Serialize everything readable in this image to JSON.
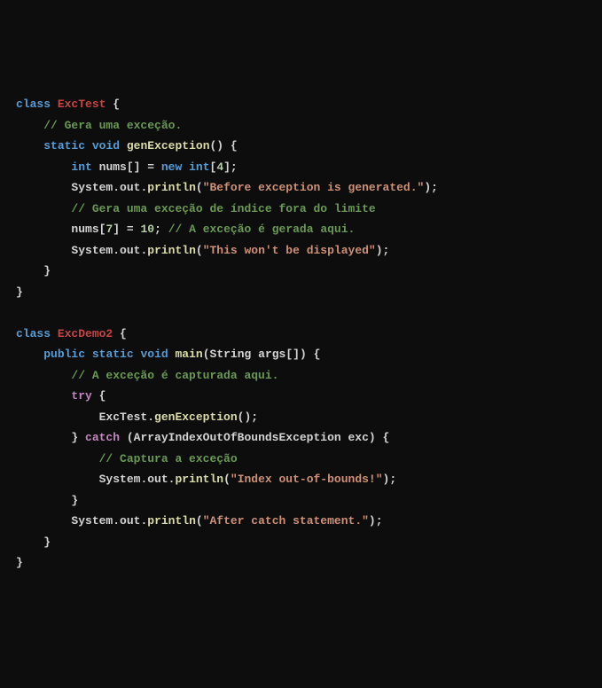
{
  "code": {
    "lines": [
      [
        {
          "cls": "kw",
          "t": "class"
        },
        {
          "cls": "pun",
          "t": " "
        },
        {
          "cls": "cls",
          "t": "ExcTest"
        },
        {
          "cls": "pun",
          "t": " {"
        }
      ],
      [
        {
          "cls": "pun",
          "t": "    "
        },
        {
          "cls": "cmt",
          "t": "// Gera uma exceção."
        }
      ],
      [
        {
          "cls": "pun",
          "t": "    "
        },
        {
          "cls": "kw",
          "t": "static"
        },
        {
          "cls": "pun",
          "t": " "
        },
        {
          "cls": "kw",
          "t": "void"
        },
        {
          "cls": "pun",
          "t": " "
        },
        {
          "cls": "mth",
          "t": "genException"
        },
        {
          "cls": "pun",
          "t": "() {"
        }
      ],
      [
        {
          "cls": "pun",
          "t": "        "
        },
        {
          "cls": "kw",
          "t": "int"
        },
        {
          "cls": "pun",
          "t": " "
        },
        {
          "cls": "id",
          "t": "nums"
        },
        {
          "cls": "pun",
          "t": "[] = "
        },
        {
          "cls": "kw",
          "t": "new"
        },
        {
          "cls": "pun",
          "t": " "
        },
        {
          "cls": "kw",
          "t": "int"
        },
        {
          "cls": "pun",
          "t": "["
        },
        {
          "cls": "num",
          "t": "4"
        },
        {
          "cls": "pun",
          "t": "];"
        }
      ],
      [
        {
          "cls": "pun",
          "t": "        "
        },
        {
          "cls": "id",
          "t": "System"
        },
        {
          "cls": "pun",
          "t": "."
        },
        {
          "cls": "id",
          "t": "out"
        },
        {
          "cls": "pun",
          "t": "."
        },
        {
          "cls": "mth",
          "t": "println"
        },
        {
          "cls": "pun",
          "t": "("
        },
        {
          "cls": "str",
          "t": "\"Before exception is generated.\""
        },
        {
          "cls": "pun",
          "t": ");"
        }
      ],
      [
        {
          "cls": "pun",
          "t": "        "
        },
        {
          "cls": "cmt",
          "t": "// Gera uma exceção de índice fora do limite"
        }
      ],
      [
        {
          "cls": "pun",
          "t": "        "
        },
        {
          "cls": "id",
          "t": "nums"
        },
        {
          "cls": "pun",
          "t": "["
        },
        {
          "cls": "num",
          "t": "7"
        },
        {
          "cls": "pun",
          "t": "] = "
        },
        {
          "cls": "num",
          "t": "10"
        },
        {
          "cls": "pun",
          "t": "; "
        },
        {
          "cls": "cmt",
          "t": "// A exceção é gerada aqui."
        }
      ],
      [
        {
          "cls": "pun",
          "t": "        "
        },
        {
          "cls": "id",
          "t": "System"
        },
        {
          "cls": "pun",
          "t": "."
        },
        {
          "cls": "id",
          "t": "out"
        },
        {
          "cls": "pun",
          "t": "."
        },
        {
          "cls": "mth",
          "t": "println"
        },
        {
          "cls": "pun",
          "t": "("
        },
        {
          "cls": "str",
          "t": "\"This won't be displayed\""
        },
        {
          "cls": "pun",
          "t": ");"
        }
      ],
      [
        {
          "cls": "pun",
          "t": "    }"
        }
      ],
      [
        {
          "cls": "pun",
          "t": "}"
        }
      ],
      [
        {
          "cls": "pun",
          "t": ""
        }
      ],
      [
        {
          "cls": "kw",
          "t": "class"
        },
        {
          "cls": "pun",
          "t": " "
        },
        {
          "cls": "cls",
          "t": "ExcDemo2"
        },
        {
          "cls": "pun",
          "t": " {"
        }
      ],
      [
        {
          "cls": "pun",
          "t": "    "
        },
        {
          "cls": "kw",
          "t": "public"
        },
        {
          "cls": "pun",
          "t": " "
        },
        {
          "cls": "kw",
          "t": "static"
        },
        {
          "cls": "pun",
          "t": " "
        },
        {
          "cls": "kw",
          "t": "void"
        },
        {
          "cls": "pun",
          "t": " "
        },
        {
          "cls": "mth",
          "t": "main"
        },
        {
          "cls": "pun",
          "t": "("
        },
        {
          "cls": "id",
          "t": "String args"
        },
        {
          "cls": "pun",
          "t": "[]) {"
        }
      ],
      [
        {
          "cls": "pun",
          "t": "        "
        },
        {
          "cls": "cmt",
          "t": "// A exceção é capturada aqui."
        }
      ],
      [
        {
          "cls": "pun",
          "t": "        "
        },
        {
          "cls": "key",
          "t": "try"
        },
        {
          "cls": "pun",
          "t": " {"
        }
      ],
      [
        {
          "cls": "pun",
          "t": "            "
        },
        {
          "cls": "id",
          "t": "ExcTest"
        },
        {
          "cls": "pun",
          "t": "."
        },
        {
          "cls": "mth",
          "t": "genException"
        },
        {
          "cls": "pun",
          "t": "();"
        }
      ],
      [
        {
          "cls": "pun",
          "t": "        } "
        },
        {
          "cls": "key",
          "t": "catch"
        },
        {
          "cls": "pun",
          "t": " ("
        },
        {
          "cls": "id",
          "t": "ArrayIndexOutOfBoundsException exc"
        },
        {
          "cls": "pun",
          "t": ") {"
        }
      ],
      [
        {
          "cls": "pun",
          "t": "            "
        },
        {
          "cls": "cmt",
          "t": "// Captura a exceção"
        }
      ],
      [
        {
          "cls": "pun",
          "t": "            "
        },
        {
          "cls": "id",
          "t": "System"
        },
        {
          "cls": "pun",
          "t": "."
        },
        {
          "cls": "id",
          "t": "out"
        },
        {
          "cls": "pun",
          "t": "."
        },
        {
          "cls": "mth",
          "t": "println"
        },
        {
          "cls": "pun",
          "t": "("
        },
        {
          "cls": "str",
          "t": "\"Index out-of-bounds!\""
        },
        {
          "cls": "pun",
          "t": ");"
        }
      ],
      [
        {
          "cls": "pun",
          "t": "        }"
        }
      ],
      [
        {
          "cls": "pun",
          "t": "        "
        },
        {
          "cls": "id",
          "t": "System"
        },
        {
          "cls": "pun",
          "t": "."
        },
        {
          "cls": "id",
          "t": "out"
        },
        {
          "cls": "pun",
          "t": "."
        },
        {
          "cls": "mth",
          "t": "println"
        },
        {
          "cls": "pun",
          "t": "("
        },
        {
          "cls": "str",
          "t": "\"After catch statement.\""
        },
        {
          "cls": "pun",
          "t": ");"
        }
      ],
      [
        {
          "cls": "pun",
          "t": "    }"
        }
      ],
      [
        {
          "cls": "pun",
          "t": "}"
        }
      ]
    ]
  }
}
